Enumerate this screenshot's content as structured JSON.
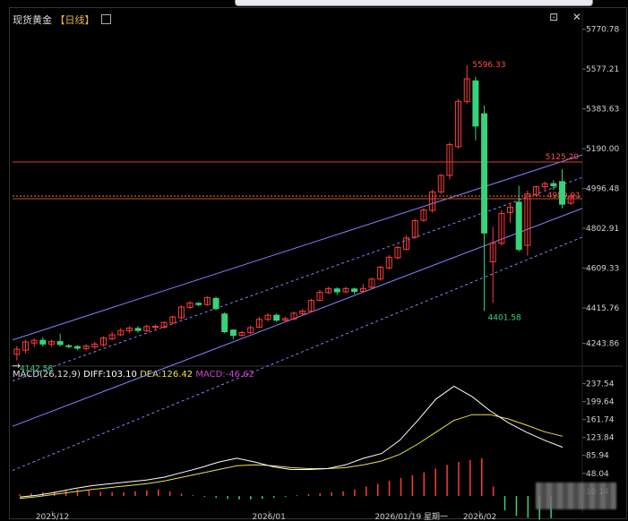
{
  "header": {
    "instrument": "现货黄金",
    "period": "【日线】",
    "window_icons": "⊡ ✕"
  },
  "macd": {
    "label": "MACD(26,12,9)",
    "diff": "DIFF:103.10",
    "dea": "DEA:126.42",
    "macd": "MACD:-46.62"
  },
  "colors": {
    "up": "#ff3b3b",
    "down": "#38d27a",
    "diff": "#ffffff",
    "dea": "#e8e24a",
    "channel": "#8080ff",
    "resistance": "#e23a3a",
    "price_line": "#ff6b3b"
  },
  "chart_data": [
    {
      "type": "candlestick",
      "title": "现货黄金【日线】",
      "ylim": [
        4150,
        5800
      ],
      "y_ticks": [
        "5770.78",
        "5577.21",
        "5383.63",
        "5190.00",
        "4996.48",
        "4802.91",
        "4609.33",
        "4415.76",
        "4243.86"
      ],
      "x_ticks": [
        "2025/12",
        "2026/01",
        "2026/01/19 星期一",
        "2026/02"
      ],
      "annotations": {
        "high_label": "5596.33",
        "low_label": "4401.58",
        "start_low_label": "4142.58",
        "resistance_label": "5125.20",
        "last_price_label": "4959.91"
      },
      "levels": {
        "resistance": 5125.2,
        "last_price": 4959.91
      },
      "channel_lines": [
        {
          "style": "solid",
          "start": 4260,
          "end": 5160
        },
        {
          "style": "dashed",
          "start": 4060,
          "end": 5050
        },
        {
          "style": "solid",
          "start": 3840,
          "end": 4900
        },
        {
          "style": "dashed",
          "start": 3625,
          "end": 4760
        }
      ],
      "candles": [
        [
          4190,
          4215,
          4160,
          4230
        ],
        [
          4210,
          4250,
          4195,
          4260
        ],
        [
          4245,
          4258,
          4225,
          4268
        ],
        [
          4258,
          4240,
          4228,
          4272
        ],
        [
          4240,
          4252,
          4226,
          4262
        ],
        [
          4252,
          4238,
          4228,
          4290
        ],
        [
          4232,
          4228,
          4220,
          4240
        ],
        [
          4228,
          4220,
          4210,
          4234
        ],
        [
          4218,
          4230,
          4208,
          4240
        ],
        [
          4226,
          4240,
          4215,
          4250
        ],
        [
          4236,
          4270,
          4228,
          4278
        ],
        [
          4266,
          4285,
          4258,
          4300
        ],
        [
          4285,
          4306,
          4278,
          4318
        ],
        [
          4305,
          4318,
          4292,
          4326
        ],
        [
          4316,
          4306,
          4296,
          4326
        ],
        [
          4305,
          4325,
          4298,
          4334
        ],
        [
          4324,
          4326,
          4312,
          4336
        ],
        [
          4322,
          4345,
          4314,
          4350
        ],
        [
          4342,
          4372,
          4336,
          4378
        ],
        [
          4368,
          4420,
          4360,
          4428
        ],
        [
          4418,
          4440,
          4410,
          4448
        ],
        [
          4438,
          4432,
          4424,
          4444
        ],
        [
          4432,
          4466,
          4426,
          4472
        ],
        [
          4462,
          4412,
          4406,
          4470
        ],
        [
          4386,
          4300,
          4292,
          4394
        ],
        [
          4308,
          4282,
          4264,
          4312
        ],
        [
          4282,
          4296,
          4276,
          4304
        ],
        [
          4296,
          4320,
          4288,
          4330
        ],
        [
          4322,
          4360,
          4318,
          4372
        ],
        [
          4360,
          4380,
          4350,
          4390
        ],
        [
          4380,
          4356,
          4348,
          4388
        ],
        [
          4356,
          4364,
          4346,
          4374
        ],
        [
          4362,
          4390,
          4356,
          4398
        ],
        [
          4388,
          4400,
          4376,
          4410
        ],
        [
          4400,
          4452,
          4394,
          4460
        ],
        [
          4452,
          4492,
          4448,
          4504
        ],
        [
          4490,
          4510,
          4484,
          4518
        ],
        [
          4508,
          4494,
          4478,
          4516
        ],
        [
          4494,
          4510,
          4486,
          4518
        ],
        [
          4508,
          4496,
          4482,
          4514
        ],
        [
          4496,
          4510,
          4490,
          4532
        ],
        [
          4516,
          4556,
          4508,
          4562
        ],
        [
          4556,
          4614,
          4548,
          4620
        ],
        [
          4610,
          4662,
          4604,
          4672
        ],
        [
          4660,
          4710,
          4652,
          4718
        ],
        [
          4700,
          4756,
          4696,
          4768
        ],
        [
          4760,
          4840,
          4752,
          4848
        ],
        [
          4842,
          4892,
          4834,
          4900
        ],
        [
          4890,
          4980,
          4880,
          4990
        ],
        [
          4980,
          5060,
          4970,
          5066
        ],
        [
          5060,
          5210,
          5040,
          5220
        ],
        [
          5200,
          5420,
          5190,
          5432
        ],
        [
          5420,
          5530,
          5410,
          5596
        ],
        [
          5520,
          5300,
          5230,
          5540
        ],
        [
          5360,
          4780,
          4401,
          5400
        ],
        [
          4640,
          4730,
          4440,
          4810
        ],
        [
          4730,
          4875,
          4720,
          4890
        ],
        [
          4880,
          4905,
          4830,
          4926
        ],
        [
          4930,
          4700,
          4690,
          5010
        ],
        [
          4720,
          4970,
          4670,
          4986
        ],
        [
          4965,
          5005,
          4958,
          5010
        ],
        [
          5005,
          5020,
          4990,
          5030
        ],
        [
          5020,
          5010,
          4988,
          5036
        ],
        [
          5030,
          4920,
          4900,
          5090
        ],
        [
          4925,
          4959,
          4918,
          4968
        ]
      ]
    },
    {
      "type": "macd",
      "ylim": [
        -30,
        250
      ],
      "y_ticks": [
        "237.54",
        "199.64",
        "161.74",
        "123.84",
        "85.94",
        "48.04",
        "10.14"
      ],
      "diff": [
        -2,
        2,
        8,
        16,
        22,
        26,
        30,
        34,
        40,
        50,
        60,
        72,
        80,
        72,
        62,
        56,
        56,
        58,
        66,
        80,
        90,
        118,
        160,
        205,
        232,
        210,
        180,
        155,
        135,
        118,
        103.1
      ],
      "dea": [
        -5,
        -1,
        4,
        9,
        14,
        18,
        22,
        26,
        32,
        40,
        48,
        56,
        64,
        66,
        64,
        60,
        58,
        58,
        60,
        66,
        74,
        88,
        110,
        135,
        160,
        172,
        172,
        163,
        150,
        136,
        126.42
      ],
      "histogram": [
        4,
        6,
        8,
        10,
        12,
        14,
        12,
        9,
        8,
        8,
        10,
        12,
        14,
        10,
        5,
        2,
        -2,
        -4,
        -6,
        -7,
        -7,
        -6,
        -4,
        -2,
        2,
        4,
        6,
        8,
        10,
        14,
        20,
        26,
        32,
        38,
        44,
        50,
        58,
        66,
        72,
        76,
        80,
        20,
        -30,
        -42,
        -46,
        -50,
        -46.62
      ]
    }
  ]
}
